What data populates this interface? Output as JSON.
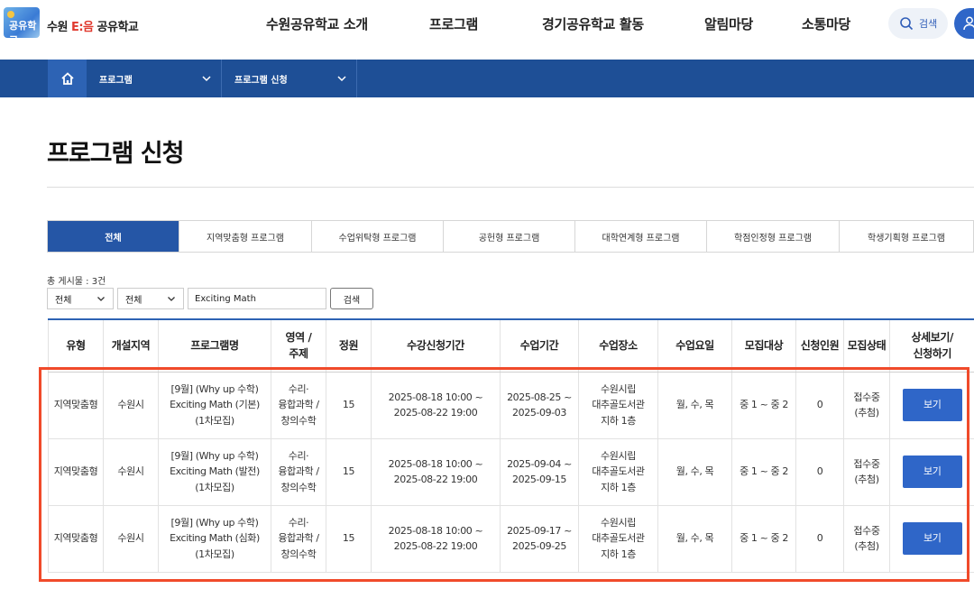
{
  "brand": {
    "prefix": "수원 ",
    "accent": "E:음",
    "suffix": " 공유학교",
    "logo_text": "공유학교",
    "logo_name": "logo-icon"
  },
  "gnb": [
    "수원공유학교 소개",
    "프로그램",
    "경기공유학교 활동",
    "알림마당",
    "소통마당"
  ],
  "header": {
    "search_label": "검색",
    "search_icon": "search-icon",
    "user_icon": "user-icon"
  },
  "location": {
    "home_icon": "home-icon",
    "items": [
      "프로그램",
      "프로그램 신청"
    ]
  },
  "page": {
    "title": "프로그램 신청"
  },
  "tabs": [
    "전체",
    "지역맞춤형 프로그램",
    "수업위탁형 프로그램",
    "공헌형 프로그램",
    "대학연계형 프로그램",
    "학점인정형 프로그램",
    "학생기획형 프로그램"
  ],
  "tab_active_index": 0,
  "filters": {
    "total": "총 게시물 : 3건",
    "select1": "전체",
    "select2": "전체",
    "keyword": "Exciting Math",
    "search_button": "검색"
  },
  "table": {
    "headers": [
      "유형",
      "개설지역",
      "프로그램명",
      "영역 /\n주제",
      "정원",
      "수강신청기간",
      "수업기간",
      "수업장소",
      "수업요일",
      "모집대상",
      "신청인원",
      "모집상태",
      "상세보기/\n신청하기"
    ],
    "rows": [
      {
        "type": "지역맞춤형",
        "region": "수원시",
        "name": "[9월] (Why up 수학)\nExciting Math (기본)\n(1차모집)",
        "area": "수리·\n융합과학 /\n창의수학",
        "capacity": "15",
        "apply_period": "2025-08-18 10:00 ~\n2025-08-22 19:00",
        "class_period": "2025-08-25 ~\n2025-09-03",
        "place": "수원시립\n대추골도서관\n지하 1층",
        "days": "월, 수, 목",
        "target": "중 1 ~ 중 2",
        "applicants": "0",
        "status": "접수중\n(추첨)",
        "action": "보기"
      },
      {
        "type": "지역맞춤형",
        "region": "수원시",
        "name": "[9월] (Why up 수학)\nExciting Math (발전)\n(1차모집)",
        "area": "수리·\n융합과학 /\n창의수학",
        "capacity": "15",
        "apply_period": "2025-08-18 10:00 ~\n2025-08-22 19:00",
        "class_period": "2025-09-04 ~\n2025-09-15",
        "place": "수원시립\n대추골도서관\n지하 1층",
        "days": "월, 수, 목",
        "target": "중 1 ~ 중 2",
        "applicants": "0",
        "status": "접수중\n(추첨)",
        "action": "보기"
      },
      {
        "type": "지역맞춤형",
        "region": "수원시",
        "name": "[9월] (Why up 수학)\nExciting Math (심화)\n(1차모집)",
        "area": "수리·\n융합과학 /\n창의수학",
        "capacity": "15",
        "apply_period": "2025-08-18 10:00 ~\n2025-08-22 19:00",
        "class_period": "2025-09-17 ~\n2025-09-25",
        "place": "수원시립\n대추골도서관\n지하 1층",
        "days": "월, 수, 목",
        "target": "중 1 ~ 중 2",
        "applicants": "0",
        "status": "접수중\n(추첨)",
        "action": "보기"
      }
    ]
  },
  "colors": {
    "primary": "#2556a6",
    "locbar": "#1e4f96",
    "button": "#2f66c8",
    "highlight": "#f04a2a",
    "accent": "#e03a2f"
  }
}
